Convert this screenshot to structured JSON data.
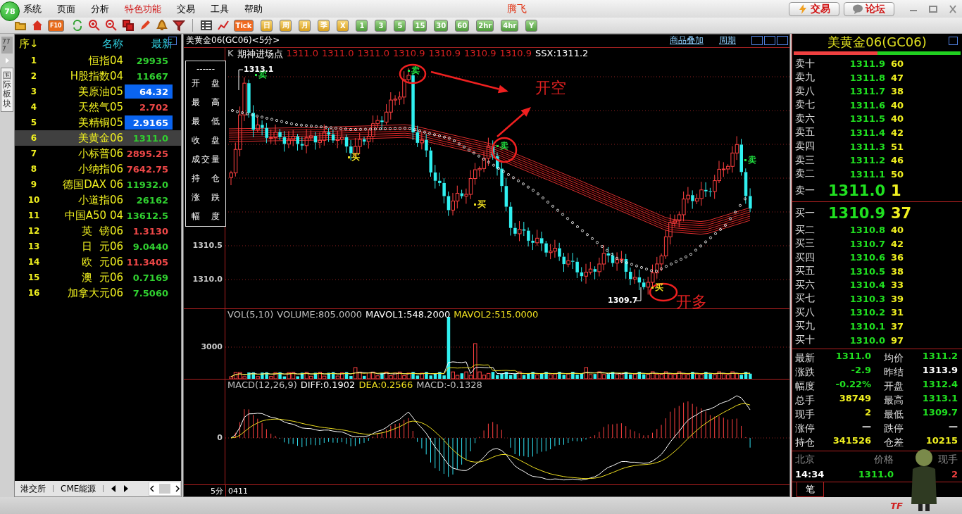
{
  "badge": "78",
  "menu": [
    {
      "label": "系统",
      "highlight": false
    },
    {
      "label": "页面",
      "highlight": false
    },
    {
      "label": "分析",
      "highlight": false
    },
    {
      "label": "特色功能",
      "highlight": true
    },
    {
      "label": "交易",
      "highlight": false
    },
    {
      "label": "工具",
      "highlight": false
    },
    {
      "label": "帮助",
      "highlight": false
    }
  ],
  "brand": "腾飞",
  "header_buttons": [
    {
      "label": "交易",
      "kind": "trade"
    },
    {
      "label": "论坛",
      "kind": "forum"
    }
  ],
  "toolbar": {
    "f10": "F10",
    "periods": [
      {
        "label": "Tick",
        "kind": "tick"
      },
      {
        "label": "日",
        "kind": "gold"
      },
      {
        "label": "周",
        "kind": "gold"
      },
      {
        "label": "月",
        "kind": "gold"
      },
      {
        "label": "季",
        "kind": "gold"
      },
      {
        "label": "X",
        "kind": "gold"
      },
      {
        "label": "1",
        "kind": "green"
      },
      {
        "label": "3",
        "kind": "green"
      },
      {
        "label": "5",
        "kind": "green"
      },
      {
        "label": "15",
        "kind": "green"
      },
      {
        "label": "30",
        "kind": "green"
      },
      {
        "label": "60",
        "kind": "green"
      },
      {
        "label": "2hr",
        "kind": "green"
      },
      {
        "label": "4hr",
        "kind": "green"
      },
      {
        "label": "Y",
        "kind": "green"
      }
    ]
  },
  "quotes": {
    "counter": "777",
    "side_tab": "国际板块",
    "columns": [
      "序↓",
      "名称",
      "最新"
    ],
    "rows": [
      {
        "no": "1",
        "name": "恒指04",
        "price": "29935",
        "color": "#30d030",
        "flash": false,
        "selected": false
      },
      {
        "no": "2",
        "name": "H股指数04",
        "price": "11667",
        "color": "#30d030",
        "flash": false,
        "selected": false
      },
      {
        "no": "3",
        "name": "美原油05",
        "price": "64.32",
        "color": "#ffffff",
        "flash": true,
        "selected": false
      },
      {
        "no": "4",
        "name": "天然气05",
        "price": "2.702",
        "color": "#f04848",
        "flash": false,
        "selected": false
      },
      {
        "no": "5",
        "name": "美精铜05",
        "price": "2.9165",
        "color": "#ffffff",
        "flash": true,
        "selected": false
      },
      {
        "no": "6",
        "name": "美黄金06",
        "price": "1311.0",
        "color": "#30d030",
        "flash": false,
        "selected": true
      },
      {
        "no": "7",
        "name": "小标普06",
        "price": "2895.25",
        "color": "#f04848",
        "flash": false,
        "selected": false
      },
      {
        "no": "8",
        "name": "小纳指06",
        "price": "7642.75",
        "color": "#f04848",
        "flash": false,
        "selected": false
      },
      {
        "no": "9",
        "name": "德国DAX 06",
        "price": "11932.0",
        "color": "#30d030",
        "flash": false,
        "selected": false
      },
      {
        "no": "10",
        "name": "小道指06",
        "price": "26162",
        "color": "#30d030",
        "flash": false,
        "selected": false
      },
      {
        "no": "11",
        "name": "中国A50 04",
        "price": "13612.5",
        "color": "#30d030",
        "flash": false,
        "selected": false
      },
      {
        "no": "12",
        "name": "英  镑06",
        "price": "1.3130",
        "color": "#f04848",
        "flash": false,
        "selected": false
      },
      {
        "no": "13",
        "name": "日  元06",
        "price": "9.0440",
        "color": "#30d030",
        "flash": false,
        "selected": false
      },
      {
        "no": "14",
        "name": "欧  元06",
        "price": "11.3405",
        "color": "#f04848",
        "flash": false,
        "selected": false
      },
      {
        "no": "15",
        "name": "澳  元06",
        "price": "0.7169",
        "color": "#30d030",
        "flash": false,
        "selected": false
      },
      {
        "no": "16",
        "name": "加拿大元06",
        "price": "7.5060",
        "color": "#30d030",
        "flash": false,
        "selected": false
      }
    ],
    "bottom_tabs": [
      "港交所",
      "CME能源"
    ]
  },
  "chart": {
    "title": "美黄金06(GC06)<5分>",
    "links": [
      "商品叠加",
      "周期"
    ],
    "legend": [
      {
        "text": "K",
        "color": "#c0c0c0"
      },
      {
        "text": "期神进场点",
        "color": "#ffffff"
      },
      {
        "text": "1311.0",
        "color": "#d82020"
      },
      {
        "text": "1311.0",
        "color": "#d82020"
      },
      {
        "text": "1311.0",
        "color": "#d82020"
      },
      {
        "text": "1310.9",
        "color": "#d82020"
      },
      {
        "text": "1310.9",
        "color": "#d82020"
      },
      {
        "text": "1310.9",
        "color": "#d82020"
      },
      {
        "text": "1310.9",
        "color": "#d82020"
      },
      {
        "text": "SSX:1311.2",
        "color": "#ffffff"
      }
    ],
    "info_box": {
      "separator": "------",
      "labels": [
        "开盘",
        "最高",
        "最低",
        "收盘",
        "成交量",
        "持仓",
        "涨跌",
        "幅度"
      ]
    },
    "y_labels": [
      "1310.5",
      "1310.0"
    ],
    "price_marks": [
      {
        "kind": "high",
        "text": "1313.1"
      },
      {
        "kind": "low",
        "text": "1309.7"
      }
    ],
    "signals": [
      {
        "kind": "sell",
        "text": "卖"
      },
      {
        "kind": "sell",
        "text": "卖"
      },
      {
        "kind": "buy",
        "text": "买"
      },
      {
        "kind": "sell",
        "text": "卖"
      },
      {
        "kind": "buy",
        "text": "买"
      },
      {
        "kind": "buy",
        "text": "买"
      },
      {
        "kind": "sell",
        "text": "卖"
      }
    ],
    "annotations": [
      "开空",
      "开多"
    ],
    "volume": {
      "legend": [
        {
          "text": "VOL(5,10)",
          "color": "#c0c0c0"
        },
        {
          "text": "VOLUME:805.0000",
          "color": "#c0c0c0"
        },
        {
          "text": "MAVOL1:548.2000",
          "color": "#ffffff"
        },
        {
          "text": "MAVOL2:515.0000",
          "color": "#f0e020"
        }
      ],
      "y_label": "3000"
    },
    "macd": {
      "legend": [
        {
          "text": "MACD(12,26,9)",
          "color": "#c0c0c0"
        },
        {
          "text": "DIFF:0.1902",
          "color": "#ffffff"
        },
        {
          "text": "DEA:0.2566",
          "color": "#f0e020"
        },
        {
          "text": "MACD:-0.1328",
          "color": "#c0c0c0"
        }
      ],
      "y_label": "0"
    },
    "x_axis": {
      "period": "5分",
      "date": "0411"
    }
  },
  "order_book": {
    "title": "美黄金06(GC06)",
    "ratio_bar": {
      "level": 0.5
    },
    "sells": [
      {
        "label": "卖十",
        "price": "1311.9",
        "volume": "60"
      },
      {
        "label": "卖九",
        "price": "1311.8",
        "volume": "47"
      },
      {
        "label": "卖八",
        "price": "1311.7",
        "volume": "38"
      },
      {
        "label": "卖七",
        "price": "1311.6",
        "volume": "40"
      },
      {
        "label": "卖六",
        "price": "1311.5",
        "volume": "40"
      },
      {
        "label": "卖五",
        "price": "1311.4",
        "volume": "42"
      },
      {
        "label": "卖四",
        "price": "1311.3",
        "volume": "51"
      },
      {
        "label": "卖三",
        "price": "1311.2",
        "volume": "46"
      },
      {
        "label": "卖二",
        "price": "1311.1",
        "volume": "50"
      },
      {
        "label": "卖一",
        "price": "1311.0",
        "volume": "1"
      }
    ],
    "buys": [
      {
        "label": "买一",
        "price": "1310.9",
        "volume": "37"
      },
      {
        "label": "买二",
        "price": "1310.8",
        "volume": "40"
      },
      {
        "label": "买三",
        "price": "1310.7",
        "volume": "42"
      },
      {
        "label": "买四",
        "price": "1310.6",
        "volume": "36"
      },
      {
        "label": "买五",
        "price": "1310.5",
        "volume": "38"
      },
      {
        "label": "买六",
        "price": "1310.4",
        "volume": "33"
      },
      {
        "label": "买七",
        "price": "1310.3",
        "volume": "39"
      },
      {
        "label": "买八",
        "price": "1310.2",
        "volume": "31"
      },
      {
        "label": "买九",
        "price": "1310.1",
        "volume": "37"
      },
      {
        "label": "买十",
        "price": "1310.0",
        "volume": "97"
      }
    ],
    "stats": [
      {
        "label": "最新",
        "value": "1311.0",
        "color": "#20e020"
      },
      {
        "label": "均价",
        "value": "1311.2",
        "color": "#20e020"
      },
      {
        "label": "涨跌",
        "value": "-2.9",
        "color": "#20e020"
      },
      {
        "label": "昨结",
        "value": "1313.9",
        "color": "#ffffff"
      },
      {
        "label": "幅度",
        "value": "-0.22%",
        "color": "#20e020"
      },
      {
        "label": "开盘",
        "value": "1312.4",
        "color": "#20e020"
      },
      {
        "label": "总手",
        "value": "38749",
        "color": "#f0f020"
      },
      {
        "label": "最高",
        "value": "1313.1",
        "color": "#20e020"
      },
      {
        "label": "现手",
        "value": "2",
        "color": "#f0f020"
      },
      {
        "label": "最低",
        "value": "1309.7",
        "color": "#20e020"
      },
      {
        "label": "涨停",
        "value": "—",
        "color": "#ffffff"
      },
      {
        "label": "跌停",
        "value": "—",
        "color": "#ffffff"
      },
      {
        "label": "持仓",
        "value": "341526",
        "color": "#f0f020"
      },
      {
        "label": "仓差",
        "value": "10215",
        "color": "#f0f020"
      }
    ],
    "ticks_header": [
      "北京",
      "价格",
      "现手"
    ],
    "ticks": [
      {
        "time": "14:34",
        "price": "1311.0",
        "volume": "2"
      }
    ],
    "tab": "笔"
  },
  "status": {
    "logo": "TF"
  }
}
